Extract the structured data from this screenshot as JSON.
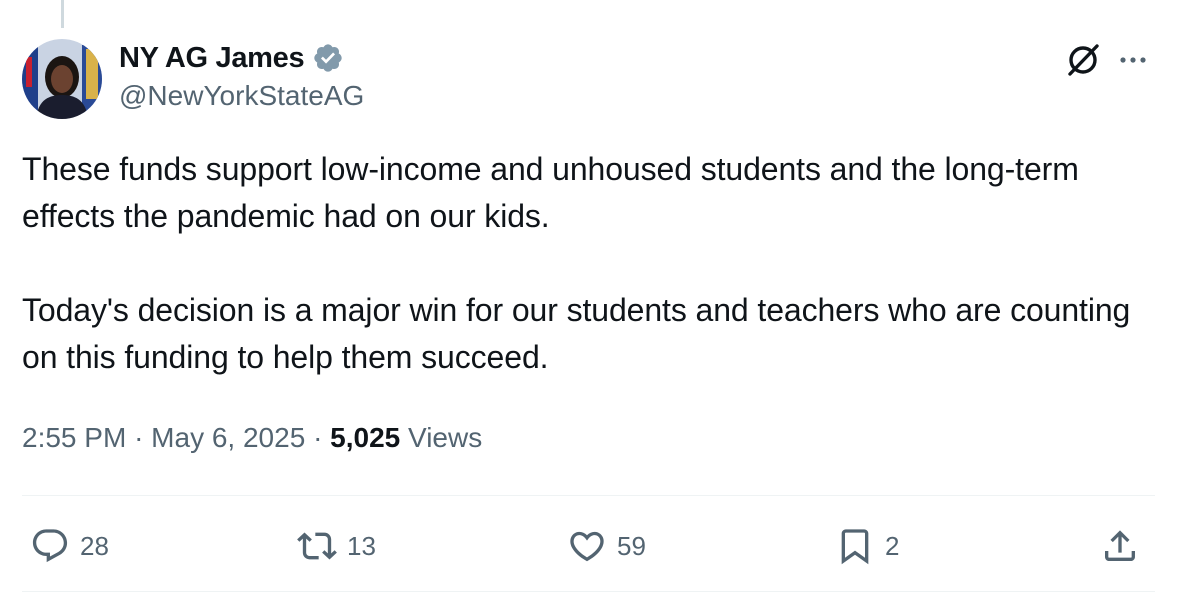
{
  "author": {
    "display_name": "NY AG James",
    "handle": "@NewYorkStateAG",
    "verified_icon": "verified-badge-icon",
    "avatar": "profile-photo"
  },
  "tweet": {
    "paragraphs": [
      "These funds support low-income and unhoused students and the long-term effects the pandemic had on our kids.",
      "Today's decision is a major win for our students and teachers who are counting on this funding to help them succeed."
    ],
    "time": "2:55 PM",
    "separator": "·",
    "date": "May 6, 2025",
    "views_count": "5,025",
    "views_label": "Views"
  },
  "actions": {
    "replies": "28",
    "reposts": "13",
    "likes": "59",
    "bookmarks": "2"
  },
  "colors": {
    "text_primary": "#0f1419",
    "text_secondary": "#536471",
    "divider": "#eff3f4",
    "verified_badge": "#829aab"
  }
}
